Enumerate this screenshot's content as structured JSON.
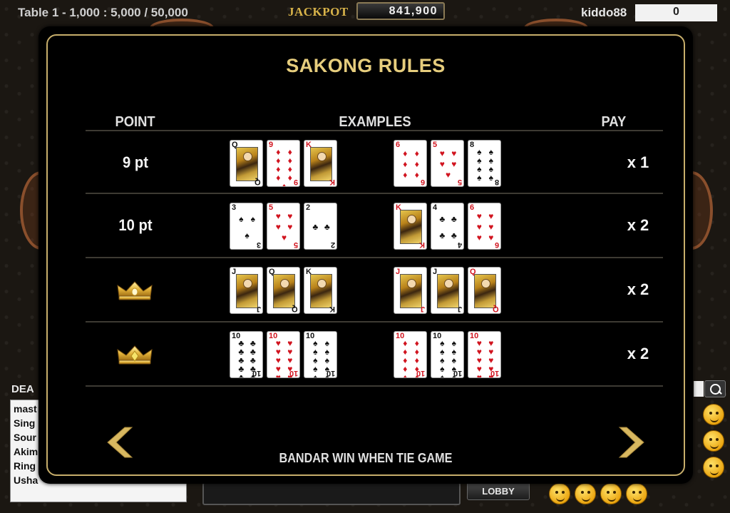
{
  "topbar": {
    "table_info": "Table 1 - 1,000 : 5,000 / 50,000",
    "jackpot_label": "JACKPOT",
    "jackpot_value": "841,900",
    "username": "kiddo88",
    "balance": "0"
  },
  "background": {
    "dealer_label": "DEA",
    "chat_lines": [
      "mast",
      "Sing",
      "Sour",
      "Akim",
      "Ring",
      "Usha"
    ],
    "lobby_label": "LOBBY"
  },
  "modal": {
    "title": "SAKONG RULES",
    "headers": {
      "point": "POINT",
      "examples": "EXAMPLES",
      "pay": "PAY"
    },
    "footer_note": "BANDAR WIN WHEN TIE GAME",
    "colors": {
      "gold": "#c7ae6b",
      "title": "#e6cd7d",
      "red_suit": "#d1141f"
    }
  },
  "rows": [
    {
      "point": "9 pt",
      "pay": "x 1",
      "cards": [
        {
          "rank": "Q",
          "suit": "♣",
          "color": "black",
          "face": true
        },
        {
          "rank": "9",
          "suit": "♦",
          "color": "red",
          "pips": 9
        },
        {
          "rank": "K",
          "suit": "♦",
          "color": "red",
          "face": true
        },
        {
          "rank": "6",
          "suit": "♦",
          "color": "red",
          "pips": 6
        },
        {
          "rank": "5",
          "suit": "♥",
          "color": "red",
          "pips": 5
        },
        {
          "rank": "8",
          "suit": "♠",
          "color": "black",
          "pips": 8
        }
      ]
    },
    {
      "point": "10 pt",
      "pay": "x 2",
      "cards": [
        {
          "rank": "3",
          "suit": "♠",
          "color": "black",
          "pips": 3
        },
        {
          "rank": "5",
          "suit": "♥",
          "color": "red",
          "pips": 5
        },
        {
          "rank": "2",
          "suit": "♣",
          "color": "black",
          "pips": 2
        },
        {
          "rank": "K",
          "suit": "♦",
          "color": "red",
          "face": true
        },
        {
          "rank": "4",
          "suit": "♣",
          "color": "black",
          "pips": 4
        },
        {
          "rank": "6",
          "suit": "♥",
          "color": "red",
          "pips": 6
        }
      ]
    },
    {
      "point": "",
      "pay": "x 2",
      "crown": true,
      "cards": [
        {
          "rank": "J",
          "suit": "♣",
          "color": "black",
          "face": true
        },
        {
          "rank": "Q",
          "suit": "♠",
          "color": "black",
          "face": true
        },
        {
          "rank": "K",
          "suit": "♠",
          "color": "black",
          "face": true
        },
        {
          "rank": "J",
          "suit": "♥",
          "color": "red",
          "face": true
        },
        {
          "rank": "J",
          "suit": "♠",
          "color": "black",
          "face": true
        },
        {
          "rank": "Q",
          "suit": "♥",
          "color": "red",
          "face": true
        }
      ]
    },
    {
      "point": "",
      "pay": "x 2",
      "crown": true,
      "cards": [
        {
          "rank": "10",
          "suit": "♣",
          "color": "black",
          "pips": 10
        },
        {
          "rank": "10",
          "suit": "♥",
          "color": "red",
          "pips": 10
        },
        {
          "rank": "10",
          "suit": "♠",
          "color": "black",
          "pips": 10
        },
        {
          "rank": "10",
          "suit": "♦",
          "color": "red",
          "pips": 10
        },
        {
          "rank": "10",
          "suit": "♠",
          "color": "black",
          "pips": 10
        },
        {
          "rank": "10",
          "suit": "♥",
          "color": "red",
          "pips": 10
        }
      ]
    }
  ]
}
